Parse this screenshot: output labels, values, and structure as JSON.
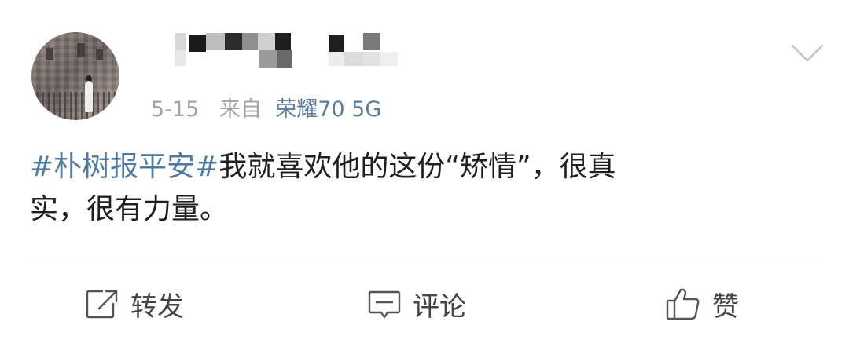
{
  "post": {
    "date": "5-15",
    "from_prefix": "来自",
    "source_device": "荣耀70 5G",
    "topic": "#朴树报平安#",
    "body_line1_after_topic": "我就喜欢他的这份“矫情”，很真",
    "body_line2": "实，很有力量。"
  },
  "actions": {
    "repost_label": "转发",
    "comment_label": "评论",
    "like_label": "赞"
  },
  "colors": {
    "link": "#4f7aa3",
    "meta_gray": "#a3a3a3",
    "text": "#1f1f1f",
    "divider": "#e8e8e8"
  },
  "icons": {
    "more": "chevron-down-icon",
    "repost": "repost-icon",
    "comment": "comment-icon",
    "like": "thumbs-up-icon"
  }
}
